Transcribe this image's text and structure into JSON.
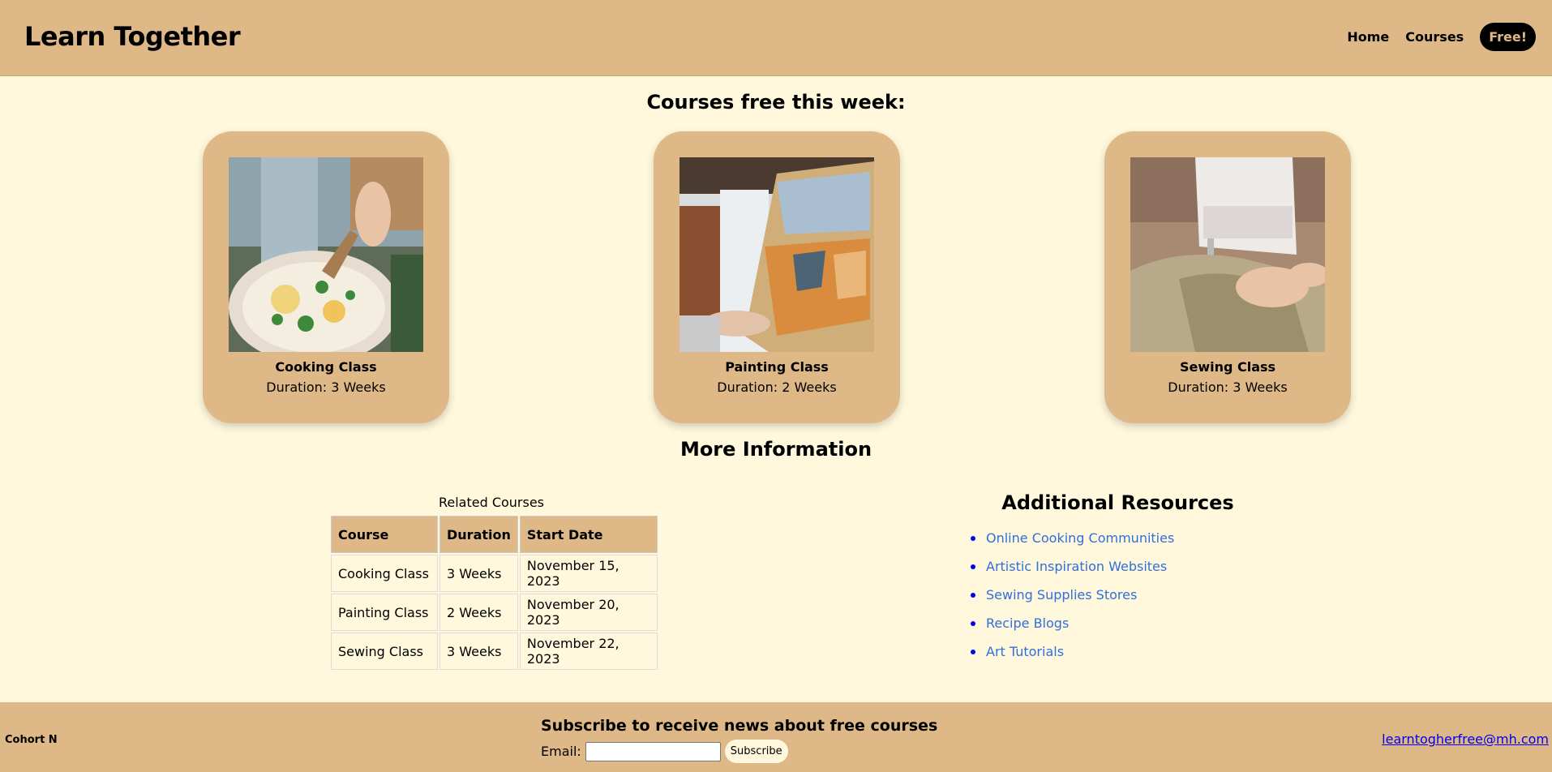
{
  "header": {
    "brand": "Learn Together",
    "nav": [
      {
        "label": "Home"
      },
      {
        "label": "Courses"
      },
      {
        "label": "Free!"
      }
    ]
  },
  "featured": {
    "title": "Courses free this week:",
    "cards": [
      {
        "name": "Cooking Class",
        "duration": "Duration: 3 Weeks",
        "image": "cooking-photo"
      },
      {
        "name": "Painting Class",
        "duration": "Duration: 2 Weeks",
        "image": "painting-photo"
      },
      {
        "name": "Sewing Class",
        "duration": "Duration: 3 Weeks",
        "image": "sewing-photo"
      }
    ]
  },
  "more_info": {
    "title": "More Information",
    "table": {
      "caption": "Related Courses",
      "headers": [
        "Course",
        "Duration",
        "Start Date"
      ],
      "rows": [
        [
          "Cooking Class",
          "3 Weeks",
          "November 15, 2023"
        ],
        [
          "Painting Class",
          "2 Weeks",
          "November 20, 2023"
        ],
        [
          "Sewing Class",
          "3 Weeks",
          "November 22, 2023"
        ]
      ]
    },
    "resources": {
      "title": "Additional Resources",
      "links": [
        "Online Cooking Communities",
        "Artistic Inspiration Websites",
        "Sewing Supplies Stores",
        "Recipe Blogs",
        "Art Tutorials"
      ]
    }
  },
  "footer": {
    "cohort": "Cohort N",
    "subscribe_title": "Subscribe to receive news about free courses",
    "email_label": "Email:",
    "email_value": "",
    "subscribe_button": "Subscribe",
    "contact_email": "learntogherfree@mh.com"
  },
  "colors": {
    "background": "#fff8dc",
    "accent": "#deb887",
    "link": "#2f6fdd"
  }
}
